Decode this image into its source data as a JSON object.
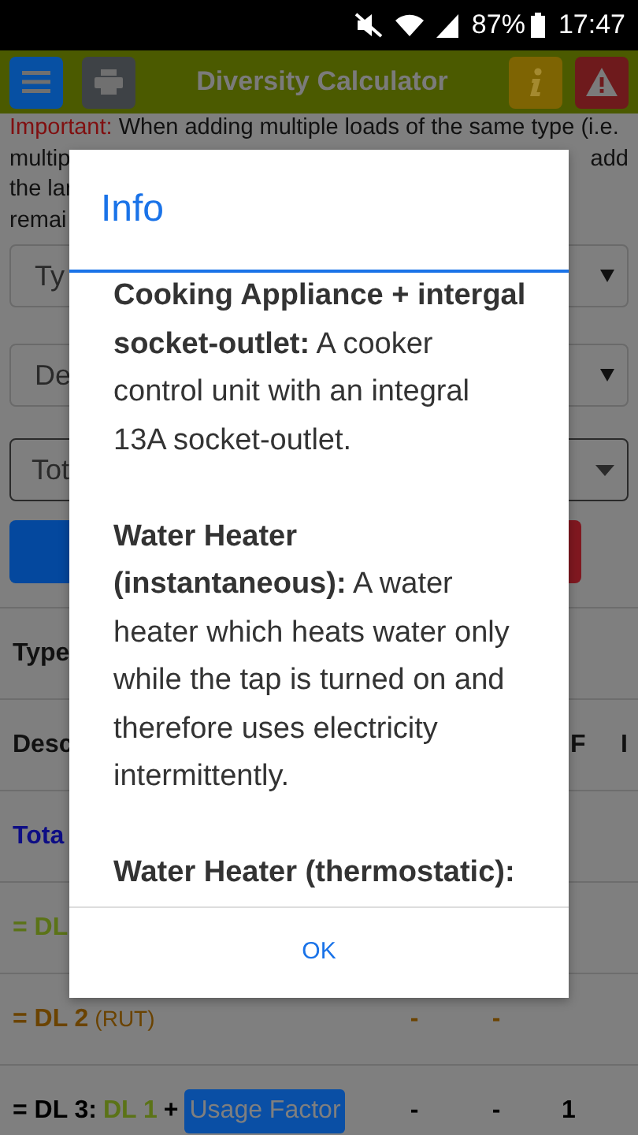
{
  "status_bar": {
    "battery": "87%",
    "time": "17:47"
  },
  "toolbar": {
    "title": "Diversity Calculator"
  },
  "note": {
    "label": "Important:",
    "lines": [
      {
        "left": "When adding multiple loads of the same type (i.e."
      },
      {
        "left": "multip",
        "right": "add"
      },
      {
        "left": "the lar"
      },
      {
        "left": "remai"
      }
    ]
  },
  "selects": [
    {
      "value": "Ty",
      "kind": "plain"
    },
    {
      "value": "De",
      "kind": "plain"
    },
    {
      "value": "Tot",
      "kind": "outlined"
    }
  ],
  "table": {
    "type_label": "Type",
    "header": {
      "description": "Desc",
      "column_f": "F",
      "column_i": "I"
    },
    "rows": [
      {
        "parts": [
          {
            "text": "Tota",
            "kind": "text",
            "color": "#0d0d85"
          }
        ],
        "cells": []
      },
      {
        "parts": [
          {
            "text": "= DL",
            "kind": "text",
            "color": "#5b7317"
          }
        ],
        "cells": []
      },
      {
        "parts": [
          {
            "text": "= DL 2",
            "kind": "text",
            "color": "#6b4300"
          },
          {
            "text": "(RUT)",
            "kind": "small",
            "color": "#6b4300"
          }
        ],
        "cells": [
          {
            "text": "-",
            "color": "#6b4300"
          },
          {
            "text": "-",
            "color": "#6b4300"
          }
        ]
      },
      {
        "parts": [
          {
            "text": "= DL 3:",
            "kind": "text",
            "color": "#000000"
          },
          {
            "text": "DL 1",
            "kind": "text",
            "color": "#5b7317"
          },
          {
            "text": "+",
            "kind": "text",
            "color": "#000000"
          },
          {
            "text": "Usage Factor",
            "kind": "badge",
            "color": "#0a4fa5"
          }
        ],
        "cells": [
          {
            "text": "-",
            "color": "#000000"
          },
          {
            "text": "-",
            "color": "#000000"
          },
          {
            "text": "1",
            "color": "#000000"
          }
        ]
      }
    ]
  },
  "dialog": {
    "title": "Info",
    "paragraphs": [
      "**Cooking Appliance + intergal socket-outlet:** A cooker control unit with an integral 13A socket-outlet.",
      "**Water Heater (instantaneous):** A water heater which heats water only while the tap is turned on and therefore uses electricity intermittently.",
      "**Water Heater (thermostatic):**"
    ],
    "button": "OK"
  }
}
